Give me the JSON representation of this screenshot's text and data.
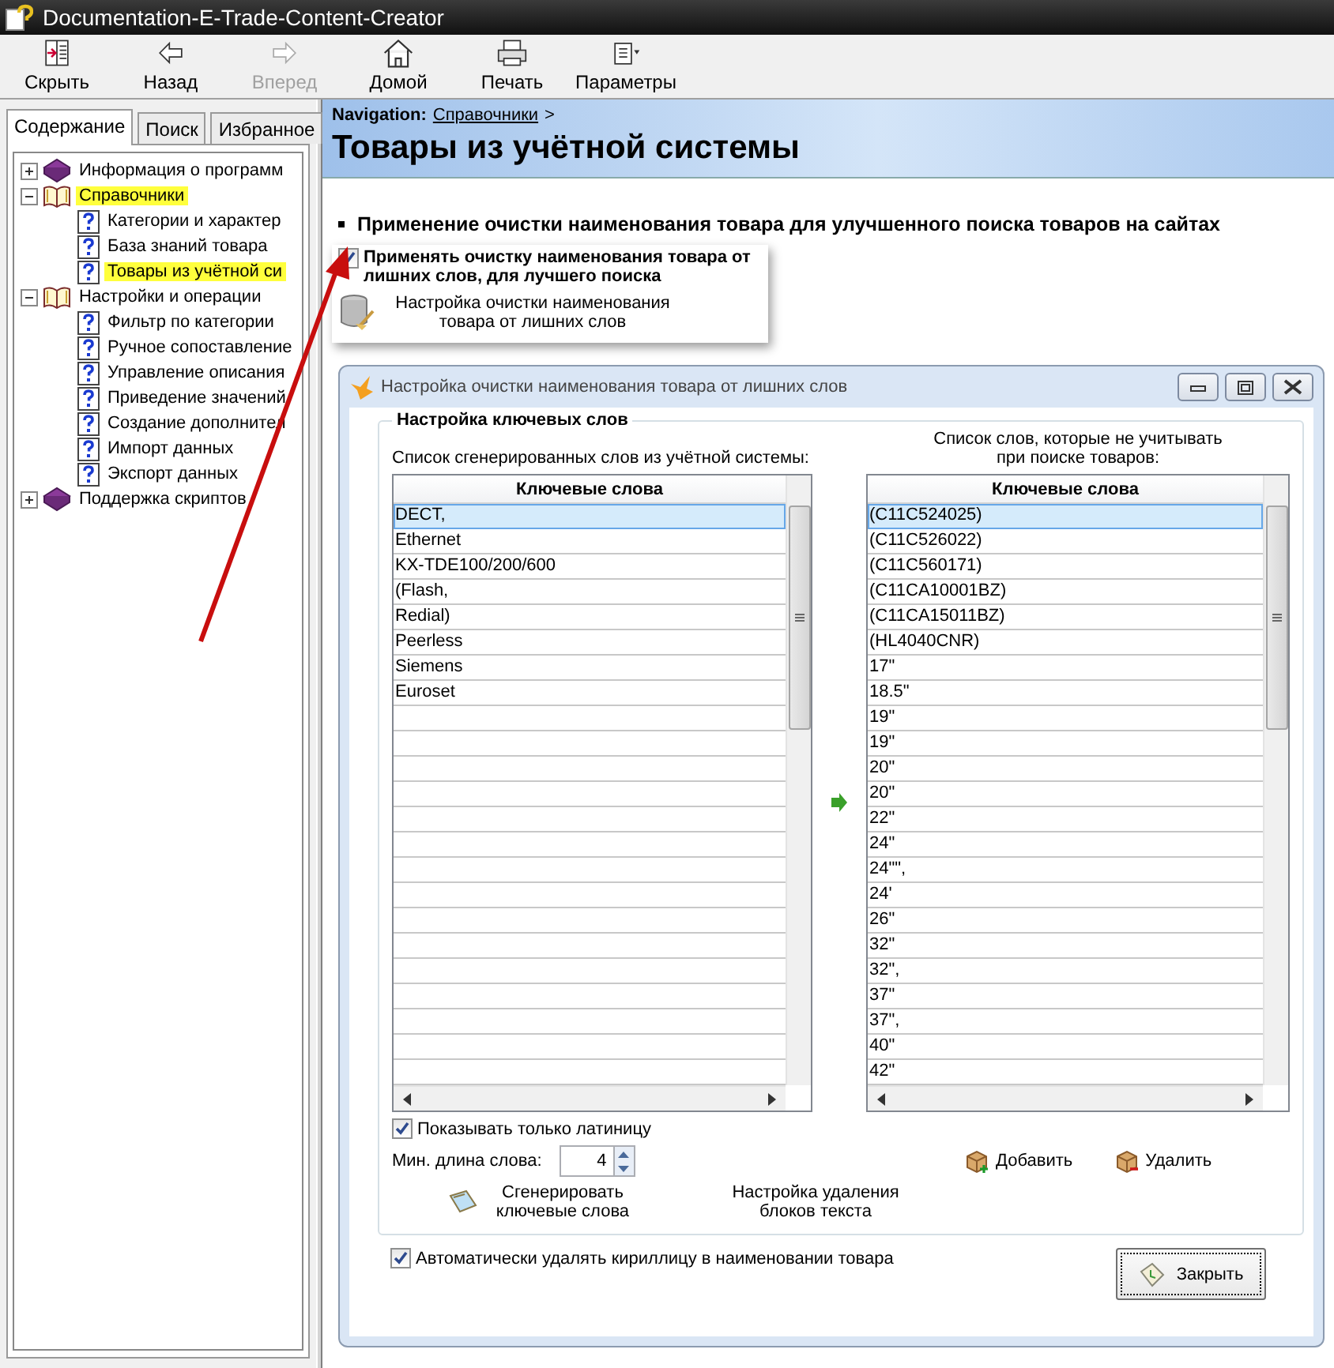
{
  "window": {
    "title": "Documentation-E-Trade-Content-Creator"
  },
  "toolbar": [
    {
      "kind": "hide",
      "label": "Скрыть",
      "disabled": false
    },
    {
      "kind": "back",
      "label": "Назад",
      "disabled": false
    },
    {
      "kind": "forward",
      "label": "Вперед",
      "disabled": true
    },
    {
      "kind": "home",
      "label": "Домой",
      "disabled": false
    },
    {
      "kind": "print",
      "label": "Печать",
      "disabled": false
    },
    {
      "kind": "options",
      "label": "Параметры",
      "disabled": false
    }
  ],
  "left_tabs": [
    {
      "label": "Содержание",
      "selected": true
    },
    {
      "label": "Поиск",
      "selected": false
    },
    {
      "label": "Избранное",
      "selected": false
    }
  ],
  "tree": [
    {
      "label": "Информация о программ",
      "kind": "book",
      "expanded": false,
      "highlighted": false
    },
    {
      "label": "Справочники",
      "kind": "book",
      "expanded": true,
      "highlighted": true,
      "children": [
        {
          "label": "Категории и характер",
          "kind": "page",
          "highlighted": false
        },
        {
          "label": "База знаний товара",
          "kind": "page",
          "highlighted": false
        },
        {
          "label": "Товары из учётной си",
          "kind": "page",
          "highlighted": true
        }
      ]
    },
    {
      "label": "Настройки и операции",
      "kind": "book",
      "expanded": true,
      "highlighted": false,
      "children": [
        {
          "label": "Фильтр по категории",
          "kind": "page",
          "highlighted": false
        },
        {
          "label": "Ручное сопоставление",
          "kind": "page",
          "highlighted": false
        },
        {
          "label": "Управление описания",
          "kind": "page",
          "highlighted": false
        },
        {
          "label": "Приведение значений",
          "kind": "page",
          "highlighted": false
        },
        {
          "label": "Создание дополнител",
          "kind": "page",
          "highlighted": false
        },
        {
          "label": "Импорт данных",
          "kind": "page",
          "highlighted": false
        },
        {
          "label": "Экспорт данных",
          "kind": "page",
          "highlighted": false
        }
      ]
    },
    {
      "label": "Поддержка скриптов",
      "kind": "book",
      "expanded": false,
      "highlighted": false
    }
  ],
  "navigation": {
    "label": "Navigation:",
    "link": "Справочники",
    "separator": ">"
  },
  "page_title": "Товары из учётной системы",
  "section_heading": "Применение очистки наименования товара для улучшенного поиска товаров на сайтах",
  "option_card": {
    "checkbox": {
      "label": "Применять очистку наименования товара от лишних слов, для лучшего поиска",
      "checked": true
    },
    "action": "Настройка очистки наименования товара от лишних слов"
  },
  "dialog": {
    "title": "Настройка очистки наименования товара от лишних слов",
    "group_title": "Настройка ключевых слов",
    "left_list": {
      "caption": "Список сгенерированных слов из учётной системы:",
      "column": "Ключевые слова",
      "rows": [
        {
          "text": "DECT,",
          "selected": true
        },
        {
          "text": "Ethernet",
          "selected": false
        },
        {
          "text": "KX-TDE100/200/600",
          "selected": false
        },
        {
          "text": "(Flash,",
          "selected": false
        },
        {
          "text": "Redial)",
          "selected": false
        },
        {
          "text": "Peerless",
          "selected": false
        },
        {
          "text": "Siemens",
          "selected": false
        },
        {
          "text": "Euroset",
          "selected": false
        }
      ]
    },
    "right_list": {
      "caption": "Список слов, которые не учитывать при поиске товаров:",
      "column": "Ключевые слова",
      "rows": [
        {
          "text": "(C11C524025)",
          "selected": true
        },
        {
          "text": "(C11C526022)",
          "selected": false
        },
        {
          "text": "(C11C560171)",
          "selected": false
        },
        {
          "text": "(C11CA10001BZ)",
          "selected": false
        },
        {
          "text": "(C11CA15011BZ)",
          "selected": false
        },
        {
          "text": "(HL4040CNR)",
          "selected": false
        },
        {
          "text": "17\"",
          "selected": false
        },
        {
          "text": "18.5\"",
          "selected": false
        },
        {
          "text": "19\"",
          "selected": false
        },
        {
          "text": "19\"",
          "selected": false
        },
        {
          "text": "20\"",
          "selected": false
        },
        {
          "text": "20\"",
          "selected": false
        },
        {
          "text": "22\"",
          "selected": false
        },
        {
          "text": "24\"",
          "selected": false
        },
        {
          "text": "24\"\",",
          "selected": false
        },
        {
          "text": "24'",
          "selected": false
        },
        {
          "text": "26\"",
          "selected": false
        },
        {
          "text": "32\"",
          "selected": false
        },
        {
          "text": "32\",",
          "selected": false
        },
        {
          "text": "37\"",
          "selected": false
        },
        {
          "text": "37\",",
          "selected": false
        },
        {
          "text": "40\"",
          "selected": false
        },
        {
          "text": "42\"",
          "selected": false
        }
      ]
    },
    "latin_only": {
      "label": "Показывать только латиницу",
      "checked": true
    },
    "min_length": {
      "label": "Мин. длина слова:",
      "value": "4"
    },
    "add_button": "Добавить",
    "remove_button": "Удалить",
    "generate_button": "Сгенерировать ключевые слова",
    "text_blocks_link": "Настройка удаления блоков текста",
    "auto_remove": {
      "label": "Автоматически удалять кириллицу в наименовании товара",
      "checked": true
    },
    "close_button": "Закрыть"
  }
}
